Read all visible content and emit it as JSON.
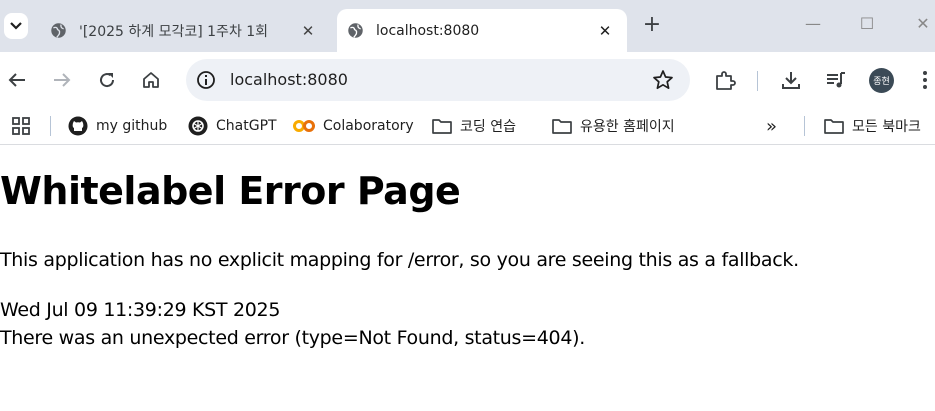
{
  "tabs": [
    {
      "title": "'[2025 하계 모각코] 1주차 1회",
      "active": false
    },
    {
      "title": "localhost:8080",
      "active": true
    }
  ],
  "omnibox": {
    "url": "localhost:8080"
  },
  "profile": {
    "initials": "종현"
  },
  "bookmarks": [
    {
      "label": "my github",
      "icon": "github-icon"
    },
    {
      "label": "ChatGPT",
      "icon": "chatgpt-icon"
    },
    {
      "label": "Colaboratory",
      "icon": "colab-icon"
    },
    {
      "label": "코딩 연습",
      "icon": "folder-icon"
    },
    {
      "label": "유용한 홈페이지",
      "icon": "folder-icon"
    },
    {
      "label": "모든 북마크",
      "icon": "folder-icon"
    }
  ],
  "page": {
    "title": "Whitelabel Error Page",
    "description": "This application has no explicit mapping for /error, so you are seeing this as a fallback.",
    "timestamp": "Wed Jul 09 11:39:29 KST 2025",
    "error": "There was an unexpected error (type=Not Found, status=404)."
  },
  "colors": {
    "accent": "#1a73e8",
    "tabstrip": "#dfe3eb",
    "omnibox": "#eef1f6"
  }
}
